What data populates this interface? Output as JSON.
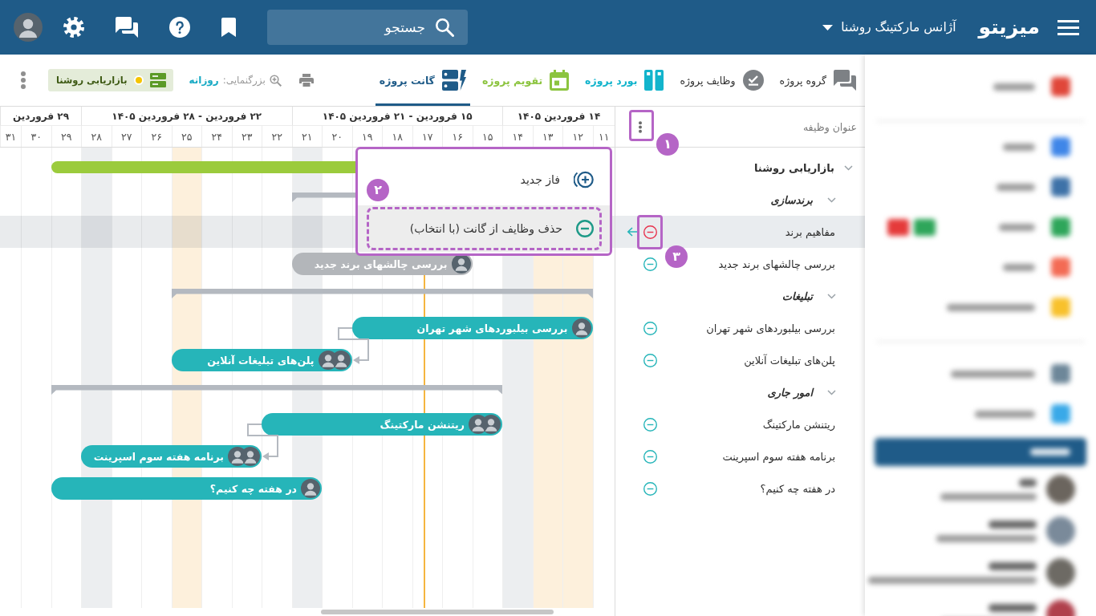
{
  "top_bar": {
    "logo": "میزیتو",
    "workspace": "آژانس مارکتینگ روشنا",
    "search": {
      "placeholder": "جستجو"
    }
  },
  "toolbar": {
    "tabs": [
      {
        "label": "گروه پروژه",
        "kind": "group",
        "color": "#7d8185",
        "selected": false
      },
      {
        "label": "وظایف پروژه",
        "kind": "tasks",
        "color": "#7d8185",
        "selected": false
      },
      {
        "label": "بورد پروژه",
        "kind": "board",
        "color": "#12b4cc",
        "selected": false
      },
      {
        "label": "تقویم پروژه",
        "kind": "calendar",
        "color": "#8cc43f",
        "selected": false
      },
      {
        "label": "گانت پروژه",
        "kind": "gantt",
        "color": "#1f5b88",
        "selected": true
      }
    ],
    "zoom": {
      "label": "بزرگنمایی:",
      "value": "روزانه"
    },
    "project_filter": {
      "label": "بازاریابی روشنا",
      "color": "#f5c400"
    }
  },
  "gantt": {
    "weeks": [
      "۱۴ فروردین ۱۴۰۵",
      "۱۵ فروردین - ۲۱ فروردین ۱۴۰۵",
      "۲۲ فروردین - ۲۸ فروردین ۱۴۰۵",
      "۲۹ فروردین"
    ],
    "days": [
      {
        "label": "۱۱",
        "kind": "workday"
      },
      {
        "label": "۱۲",
        "kind": "holiday"
      },
      {
        "label": "۱۳",
        "kind": "holiday"
      },
      {
        "label": "۱۴",
        "kind": "weekend"
      },
      {
        "label": "۱۵",
        "kind": "workday"
      },
      {
        "label": "۱۶",
        "kind": "workday"
      },
      {
        "label": "۱۷",
        "kind": "workday"
      },
      {
        "label": "۱۸",
        "kind": "workday"
      },
      {
        "label": "۱۹",
        "kind": "workday"
      },
      {
        "label": "۲۰",
        "kind": "workday"
      },
      {
        "label": "۲۱",
        "kind": "weekend"
      },
      {
        "label": "۲۲",
        "kind": "workday"
      },
      {
        "label": "۲۳",
        "kind": "workday"
      },
      {
        "label": "۲۴",
        "kind": "workday"
      },
      {
        "label": "۲۵",
        "kind": "holiday"
      },
      {
        "label": "۲۶",
        "kind": "workday"
      },
      {
        "label": "۲۷",
        "kind": "workday"
      },
      {
        "label": "۲۸",
        "kind": "weekend"
      },
      {
        "label": "۲۹",
        "kind": "workday"
      },
      {
        "label": "۳۰",
        "kind": "workday"
      },
      {
        "label": "۳۱",
        "kind": "workday"
      }
    ]
  },
  "task_list": {
    "header": "عنوان وظیفه",
    "rows": [
      {
        "kind": "project",
        "title": "بازاریابی روشنا",
        "expanded": true,
        "selected": false,
        "bar": {
          "color": "#9bcb3c"
        },
        "children": [
          {
            "kind": "phase",
            "title": "برندسازی",
            "expanded": true,
            "selected": false,
            "children": [
              {
                "kind": "task",
                "title": "مفاهیم برند",
                "selected": true,
                "successor_link": false
              },
              {
                "kind": "task",
                "title": "بررسی چالشهای برند جدید",
                "selected": false,
                "successor_link": false,
                "bar": {
                  "label": "بررسی چالشهای برند جدید",
                  "color": "#b3b6ba"
                }
              }
            ]
          },
          {
            "kind": "phase",
            "title": "تبلیغات",
            "expanded": true,
            "selected": false,
            "children": [
              {
                "kind": "task",
                "title": "بررسی بیلبوردهای شهر تهران",
                "selected": false,
                "successor_link": true,
                "bar": {
                  "label": "بررسی بیلبوردهای شهر تهران",
                  "color": "#26b5b9"
                }
              },
              {
                "kind": "task",
                "title": "پلن‌های تبلیغات آنلاین",
                "selected": false,
                "successor_link": false,
                "bar": {
                  "label": "پلن‌های تبلیغات آنلاین",
                  "color": "#26b5b9"
                }
              }
            ]
          },
          {
            "kind": "phase",
            "title": "امور جاری",
            "expanded": true,
            "selected": false,
            "children": [
              {
                "kind": "task",
                "title": "ریتنشن مارکتینگ",
                "selected": false,
                "successor_link": true,
                "bar": {
                  "label": "ریتنشن مارکتینگ",
                  "color": "#26b5b9"
                }
              },
              {
                "kind": "task",
                "title": "برنامه هفته سوم اسپرینت",
                "selected": false,
                "successor_link": false,
                "bar": {
                  "label": "برنامه هفته سوم اسپرینت",
                  "color": "#26b5b9"
                }
              },
              {
                "kind": "task",
                "title": "در هفته چه کنیم؟",
                "selected": false,
                "successor_link": false,
                "bar": {
                  "label": "در هفته چه کنیم؟",
                  "color": "#26b5b9"
                }
              }
            ]
          }
        ]
      }
    ]
  },
  "context_menu": {
    "items": [
      {
        "label": "فاز جدید",
        "kind": "add",
        "highlighted": false
      },
      {
        "label": "حذف وظایف از گانت (با انتخاب)",
        "kind": "remove",
        "highlighted": true
      }
    ]
  },
  "tour_steps": [
    {
      "number": "۱"
    },
    {
      "number": "۲"
    },
    {
      "number": "۳"
    }
  ]
}
